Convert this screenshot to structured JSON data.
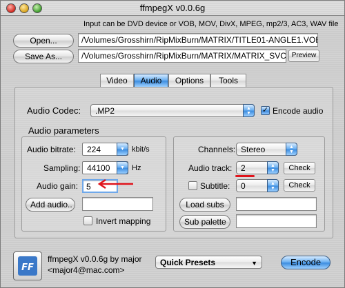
{
  "window": {
    "title": "ffmpegX v0.0.6g"
  },
  "header": {
    "hint": "Input can be DVD device or VOB, MOV, DivX, MPEG, mp2/3, AC3, WAV file",
    "open_label": "Open...",
    "save_as_label": "Save As...",
    "input_path": "/Volumes/Grosshirn/RipMixBurn/MATRIX/TITLE01-ANGLE1.VOB",
    "output_path": "/Volumes/Grosshirn/RipMixBurn/MATRIX/MATRIX_SVCD",
    "preview_label": "Preview"
  },
  "tabs": [
    {
      "label": "Video",
      "active": false
    },
    {
      "label": "Audio",
      "active": true
    },
    {
      "label": "Options",
      "active": false
    },
    {
      "label": "Tools",
      "active": false
    }
  ],
  "audio": {
    "codec_label": "Audio Codec:",
    "codec_value": ".MP2",
    "encode_audio_label": "Encode audio",
    "encode_audio_checked": true,
    "params_heading": "Audio parameters",
    "bitrate_label": "Audio bitrate:",
    "bitrate_value": "224",
    "bitrate_unit": "kbit/s",
    "sampling_label": "Sampling:",
    "sampling_value": "44100",
    "sampling_unit": "Hz",
    "gain_label": "Audio gain:",
    "gain_value": "5",
    "add_audio_label": "Add audio..",
    "add_audio_value": "",
    "invert_mapping_label": "Invert mapping",
    "invert_mapping_checked": false,
    "channels_label": "Channels:",
    "channels_value": "Stereo",
    "track_label": "Audio track:",
    "track_value": "2",
    "subtitle_label": "Subtitle:",
    "subtitle_value": "0",
    "subtitle_checked": false,
    "check_label": "Check",
    "load_subs_label": "Load subs",
    "sub_palette_label": "Sub palette",
    "load_subs_value": "",
    "sub_palette_value": ""
  },
  "footer": {
    "version_line1": "ffmpegX v0.0.6g by major",
    "version_line2": "<major4@mac.com>",
    "presets_label": "Quick Presets",
    "encode_label": "Encode"
  },
  "annotations": {
    "arrow_color": "#e0141c",
    "underline_color": "#e0141c"
  }
}
